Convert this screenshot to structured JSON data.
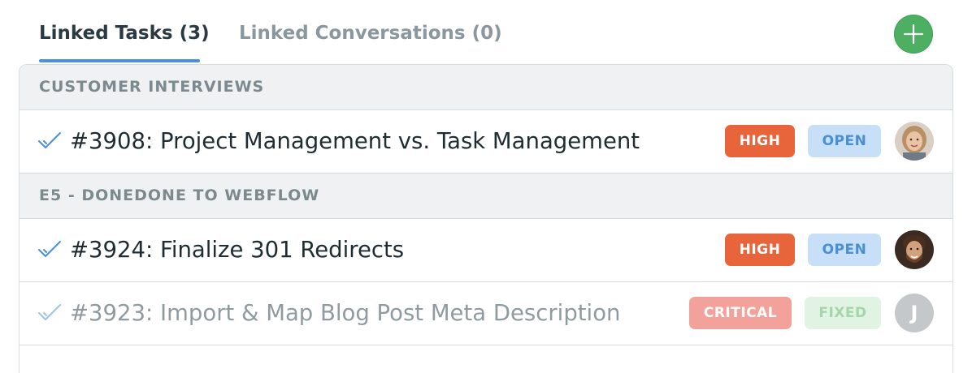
{
  "tabs": {
    "linked_tasks": "Linked Tasks (3)",
    "linked_conversations": "Linked Conversations (0)"
  },
  "add_button": {
    "icon": "plus-icon",
    "color": "#4caf62"
  },
  "groups": [
    {
      "label": "CUSTOMER INTERVIEWS",
      "tasks": [
        {
          "title": "#3908: Project Management vs. Task Management",
          "priority": "HIGH",
          "status": "OPEN",
          "avatar": "avatar-photo-woman",
          "checked": true
        }
      ]
    },
    {
      "label": "E5 - DONEDONE TO WEBFLOW",
      "tasks": [
        {
          "title": "#3924: Finalize 301 Redirects",
          "priority": "HIGH",
          "status": "OPEN",
          "avatar": "avatar-photo-man",
          "checked": true
        },
        {
          "title": "#3923: Import & Map Blog Post Meta Description",
          "priority": "CRITICAL",
          "status": "FIXED",
          "avatar_initial": "J",
          "checked": true
        }
      ]
    }
  ],
  "colors": {
    "accent": "#4a90e2",
    "high": "#e8643a",
    "open_bg": "#c7e0f7",
    "open_text": "#4a8fd6",
    "critical": "#f3a29b",
    "fixed_bg": "#e1f3e3",
    "fixed_text": "#a4d6ab"
  }
}
